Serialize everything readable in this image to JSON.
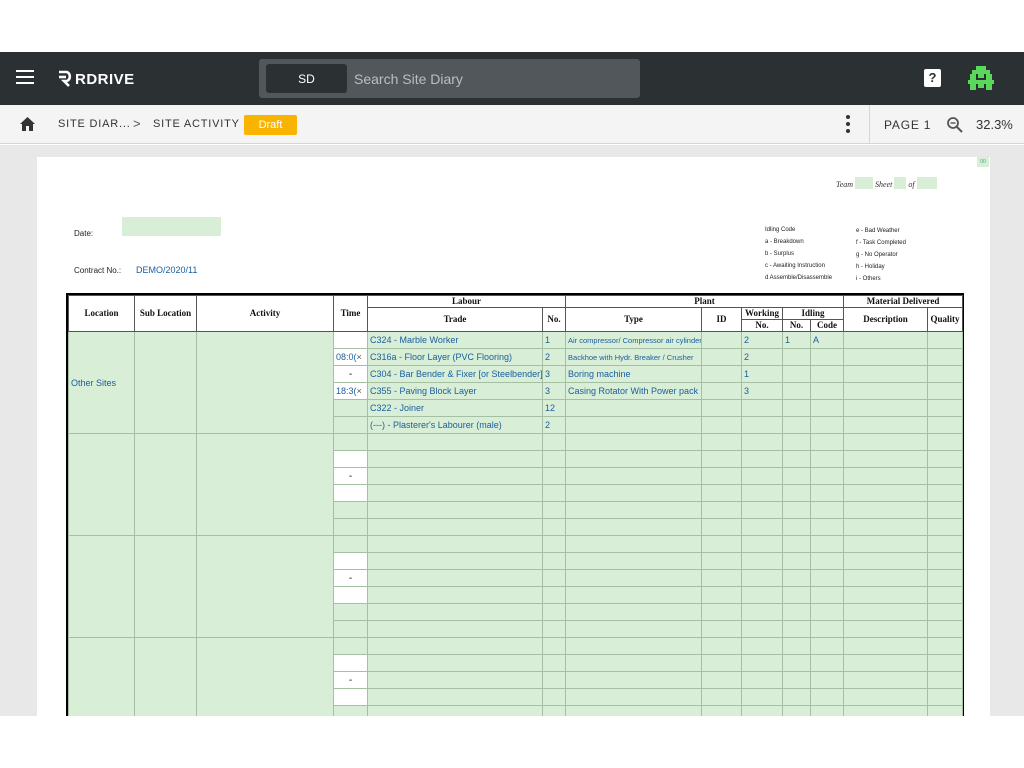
{
  "app": {
    "logo_text": "RDRIVE",
    "search": {
      "prefix": "SD",
      "placeholder": "Search Site Diary"
    },
    "help_label": "?"
  },
  "breadcrumb": {
    "items": [
      "SITE DIAR...",
      "SITE ACTIVITY"
    ],
    "separator": ">",
    "status_badge": "Draft"
  },
  "toolbar": {
    "page_label": "PAGE 1",
    "zoom_value": "32.3%"
  },
  "document": {
    "corner_mark": "00",
    "team_label": "Team",
    "sheet_label": "Sheet",
    "of_label": "of",
    "date_label": "Date:",
    "contract_label": "Contract No.:",
    "contract_value": "DEMO/2020/11",
    "idling_codes": [
      "Idling Code",
      "a - Breakdown",
      "b - Surplus",
      "c - Awaiting Instruction",
      "d Assemble/Disassemble"
    ],
    "idling_codes_2": [
      "e - Bad Weather",
      "f - Task Completed",
      "g - No Operator",
      "h - Holiday",
      "i - Others"
    ],
    "headers": {
      "location": "Location",
      "sub_location": "Sub Location",
      "activity": "Activity",
      "time": "Time",
      "labour": "Labour",
      "trade": "Trade",
      "no": "No.",
      "plant": "Plant",
      "type": "Type",
      "id": "ID",
      "working": "Working",
      "working_no": "No.",
      "idling": "Idling",
      "idling_no": "No.",
      "code": "Code",
      "material": "Material Delivered",
      "description": "Description",
      "quality": "Quality"
    },
    "block1": {
      "location": "Other Sites",
      "time_start": "08:0(",
      "time_end": "18:3(",
      "time_sep": "-",
      "clear": "×",
      "rows": [
        {
          "trade": "C324 - Marble Worker",
          "no": "1",
          "type": "Air compressor/ Compressor air cylinder",
          "working": "2",
          "idling_no": "1",
          "code": "A"
        },
        {
          "trade": "C316a - Floor Layer (PVC Flooring)",
          "no": "2",
          "type": "Backhoe with Hydr. Breaker / Crusher",
          "working": "2",
          "idling_no": "",
          "code": ""
        },
        {
          "trade": "C304 - Bar Bender & Fixer [or Steelbender]",
          "no": "3",
          "type": "Boring machine",
          "working": "1",
          "idling_no": "",
          "code": ""
        },
        {
          "trade": "C355 - Paving Block Layer",
          "no": "3",
          "type": "Casing Rotator With Power pack",
          "working": "3",
          "idling_no": "",
          "code": ""
        },
        {
          "trade": "C322 - Joiner",
          "no": "12",
          "type": "",
          "working": "",
          "idling_no": "",
          "code": ""
        },
        {
          "trade": "(---) - Plasterer's Labourer (male)",
          "no": "2",
          "type": "",
          "working": "",
          "idling_no": "",
          "code": ""
        }
      ]
    },
    "empty_block_sep": "-"
  }
}
